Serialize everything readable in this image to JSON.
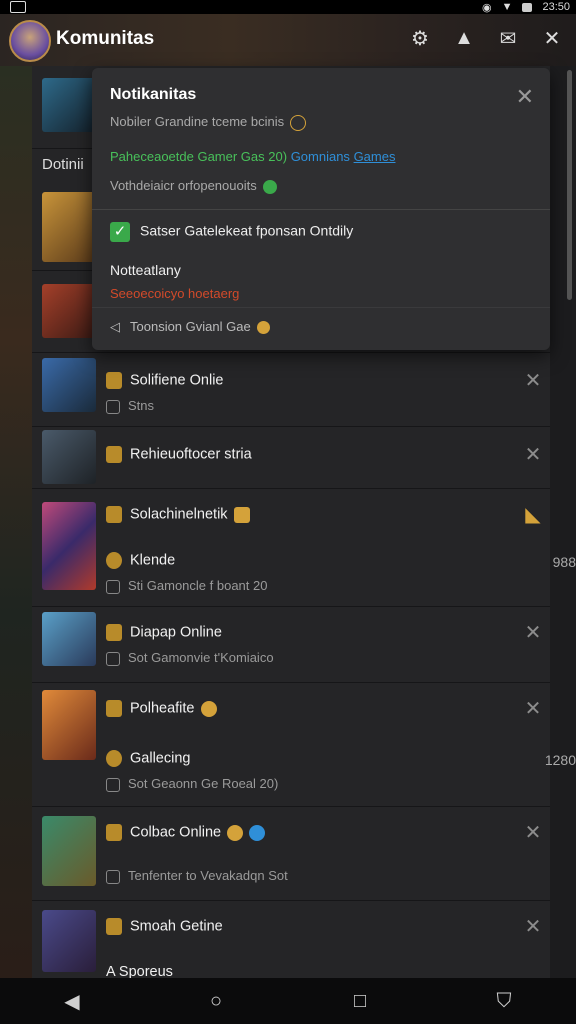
{
  "statusbar": {
    "time": "23:50"
  },
  "header": {
    "title": "Komunitas"
  },
  "sidebar_heading": "Dotinii",
  "panel": {
    "title": "Notikanitas",
    "line1": "Nobiler Grandine tceme bcinis",
    "line2_green": "Paheceaoetde Gamer Gas 20)",
    "line2_blue1": "Gomnians",
    "line2_blue2": "Games",
    "line3": "Vothdeiaicr orfopenouoits",
    "check_text": "Satser Gatelekeat fponsan Ontdily",
    "section_title": "Notteatlany",
    "section_red": "Seeoecoicyo hoetaerg",
    "footer": "Toonsion Gvianl Gae"
  },
  "rows": [
    {
      "title": "Solifiene Onlie",
      "sub": "Stns"
    },
    {
      "title": "Rehieuoftocer stria",
      "sub": ""
    },
    {
      "title": "Solachinelnetik",
      "sub": "",
      "title2": "Klende",
      "sub2": "Sti Gamoncle f boant 20",
      "right": "988"
    },
    {
      "title": "Diapap Online",
      "sub": "Sot Gamonvie t'Komiaico"
    },
    {
      "title": "Polheafite",
      "sub": "",
      "title2": "Gallecing",
      "sub2": "Sot Geaonn Ge Roeal 20)",
      "right": "1280"
    },
    {
      "title": "Colbac Online",
      "sub": "Tenfenter to Vevakadqn Sot"
    },
    {
      "title": "Smoah Getine",
      "sub": "",
      "title2": "A Sporeus",
      "sub2": ""
    }
  ],
  "colors": {
    "accent_green": "#3aa94a",
    "accent_blue": "#2f8fd8",
    "accent_red": "#d24a2a",
    "badge_gold": "#b88b2a"
  }
}
